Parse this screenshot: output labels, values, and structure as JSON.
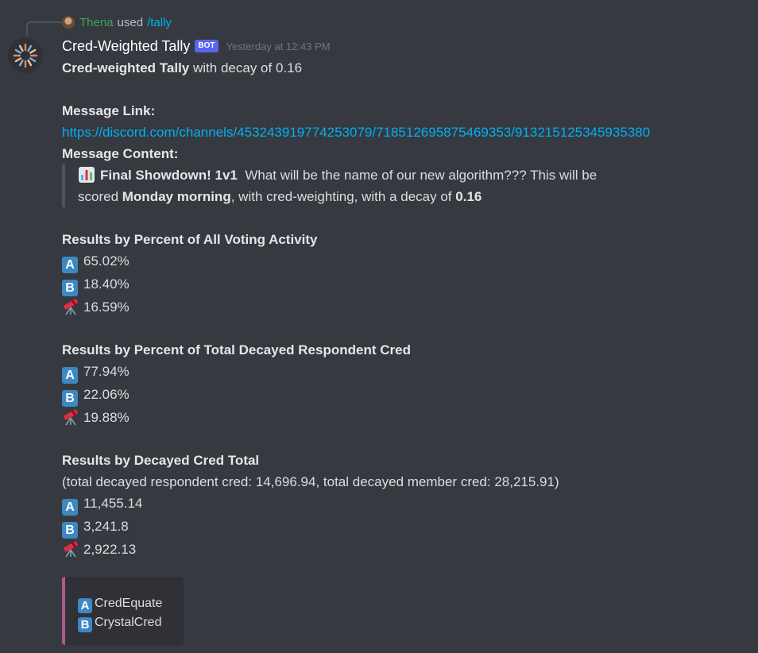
{
  "reply": {
    "user": "Thena",
    "verb": "used",
    "command": "/tally"
  },
  "message": {
    "author": "Cred-Weighted Tally",
    "bot_tag": "BOT",
    "timestamp": "Yesterday at 12:43 PM"
  },
  "intro": {
    "bold": "Cred-weighted Tally",
    "rest": "with decay of 0.16"
  },
  "link_label": "Message Link:",
  "link_url": "https://discord.com/channels/453243919774253079/718512695875469353/913215125345935380",
  "content_label": "Message Content:",
  "quote": {
    "emoji": "chart-icon",
    "title": "Final Showdown! 1v1",
    "line1_rest": "What will be the name of our new algorithm??? This will be",
    "line2_pre": "scored",
    "line2_bold": "Monday morning",
    "line2_mid": ", with cred-weighting, with a decay of",
    "line2_value": "0.16"
  },
  "sections": [
    {
      "title": "Results by Percent of All Voting Activity",
      "rows": [
        {
          "icon": "A",
          "value": "65.02%"
        },
        {
          "icon": "B",
          "value": "18.40%"
        },
        {
          "icon": "telescope",
          "value": "16.59%"
        }
      ]
    },
    {
      "title": "Results by Percent of Total Decayed Respondent Cred",
      "rows": [
        {
          "icon": "A",
          "value": "77.94%"
        },
        {
          "icon": "B",
          "value": "22.06%"
        },
        {
          "icon": "telescope",
          "value": "19.88%"
        }
      ]
    },
    {
      "title": "Results by Decayed Cred Total",
      "subtitle": "(total decayed respondent cred: 14,696.94, total decayed member cred: 28,215.91)",
      "rows": [
        {
          "icon": "A",
          "value": "11,455.14"
        },
        {
          "icon": "B",
          "value": "3,241.8"
        },
        {
          "icon": "telescope",
          "value": "2,922.13"
        }
      ]
    }
  ],
  "embed": {
    "accent": "#b05a8e",
    "options": [
      {
        "icon": "A",
        "label": "CredEquate"
      },
      {
        "icon": "B",
        "label": "CrystalCred"
      }
    ]
  },
  "colors": {
    "background": "#36393f",
    "link": "#00aff4",
    "regional_indicator": "#3b88c3",
    "bot_tag": "#5865f2"
  }
}
